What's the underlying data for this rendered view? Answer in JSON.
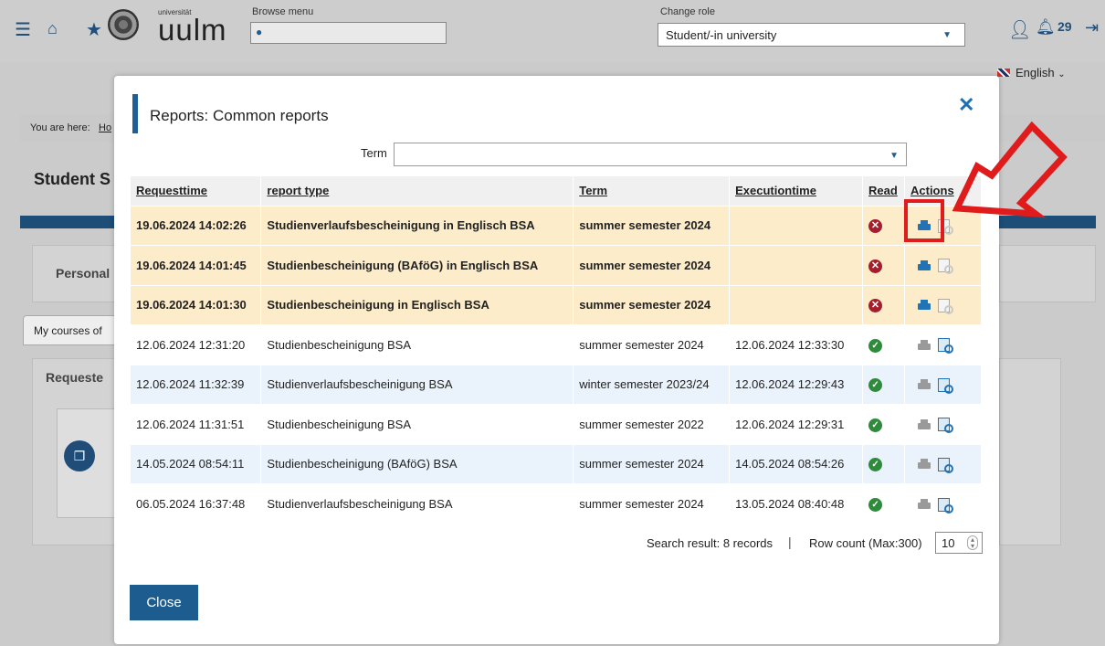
{
  "topbar": {
    "logo_small": "universität",
    "logo_main": "uulm",
    "browse_label": "Browse menu",
    "browse_placeholder": "",
    "role_label": "Change role",
    "role_value": "Student/-in university",
    "notifications": "29"
  },
  "language": "English",
  "background": {
    "breadcrumb_prefix": "You are here:",
    "breadcrumb_home": "Ho",
    "page_title": "Student S",
    "personal_tab": "Personal",
    "courses_tab": "My courses of",
    "requested": "Requeste"
  },
  "modal": {
    "title": "Reports: Common reports",
    "term_label": "Term",
    "term_value": "",
    "columns": [
      "Requesttime",
      "report type",
      "Term",
      "Executiontime",
      "Read",
      "Actions"
    ],
    "rows": [
      {
        "time": "19.06.2024 14:02:26",
        "type": "Studienverlaufsbescheinigung in Englisch BSA",
        "term": "summer semester 2024",
        "exec": "",
        "read": false,
        "highlight": true
      },
      {
        "time": "19.06.2024 14:01:45",
        "type": "Studienbescheinigung (BAföG) in Englisch BSA",
        "term": "summer semester 2024",
        "exec": "",
        "read": false,
        "highlight": false
      },
      {
        "time": "19.06.2024 14:01:30",
        "type": "Studienbescheinigung in Englisch BSA",
        "term": "summer semester 2024",
        "exec": "",
        "read": false,
        "highlight": false
      },
      {
        "time": "12.06.2024 12:31:20",
        "type": "Studienbescheinigung BSA",
        "term": "summer semester 2024",
        "exec": "12.06.2024 12:33:30",
        "read": true,
        "highlight": false
      },
      {
        "time": "12.06.2024 11:32:39",
        "type": "Studienverlaufsbescheinigung BSA",
        "term": "winter semester 2023/24",
        "exec": "12.06.2024 12:29:43",
        "read": true,
        "highlight": false
      },
      {
        "time": "12.06.2024 11:31:51",
        "type": "Studienbescheinigung BSA",
        "term": "summer semester 2022",
        "exec": "12.06.2024 12:29:31",
        "read": true,
        "highlight": false
      },
      {
        "time": "14.05.2024 08:54:11",
        "type": "Studienbescheinigung (BAföG) BSA",
        "term": "summer semester 2024",
        "exec": "14.05.2024 08:54:26",
        "read": true,
        "highlight": false
      },
      {
        "time": "06.05.2024 16:37:48",
        "type": "Studienverlaufsbescheinigung BSA",
        "term": "summer semester 2024",
        "exec": "13.05.2024 08:40:48",
        "read": true,
        "highlight": false
      }
    ],
    "search_result": "Search result: 8 records",
    "row_count_label": "Row count (Max:300)",
    "row_count_value": "10",
    "close_label": "Close"
  },
  "colors": {
    "accent": "#1c5c8f",
    "unread_bg": "#fcecc9",
    "read_bg": "#eaf3fb",
    "annotation": "#e01b1b"
  },
  "icons": [
    "menu-icon",
    "home-icon",
    "star-icon",
    "search-icon",
    "user-icon",
    "bell-icon",
    "logout-icon",
    "uk-flag-icon",
    "close-icon",
    "print-icon",
    "preview-icon",
    "unread-icon",
    "read-icon"
  ]
}
